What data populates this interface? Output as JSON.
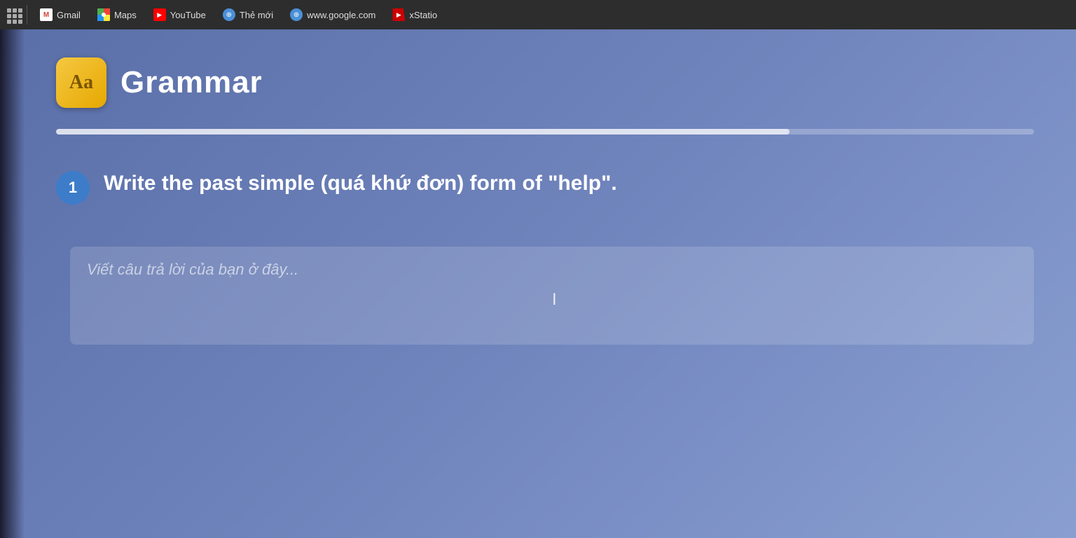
{
  "browser": {
    "toolbar": {
      "grid_label": "apps",
      "tabs": [
        {
          "id": "gmail",
          "label": "Gmail",
          "icon_type": "gmail"
        },
        {
          "id": "maps",
          "label": "Maps",
          "icon_type": "maps"
        },
        {
          "id": "youtube",
          "label": "YouTube",
          "icon_type": "youtube"
        },
        {
          "id": "the-moi",
          "label": "Thẻ mới",
          "icon_type": "globe"
        },
        {
          "id": "google",
          "label": "www.google.com",
          "icon_type": "globe"
        },
        {
          "id": "xstation",
          "label": "xStatio",
          "icon_type": "xstation"
        }
      ]
    }
  },
  "main": {
    "grammar_title": "Grammar",
    "grammar_icon_text": "Aa",
    "progress_percent": 75,
    "question": {
      "number": "1",
      "text": "Write the past simple (quá khứ đơn) form of \"help\"."
    },
    "answer_placeholder": "Viết câu trả lời của bạn ở đây..."
  },
  "colors": {
    "bg_start": "#5a6fa8",
    "bg_end": "#8a9fd0",
    "question_number_bg": "#3d7cc9",
    "icon_bg": "#f5c842"
  }
}
